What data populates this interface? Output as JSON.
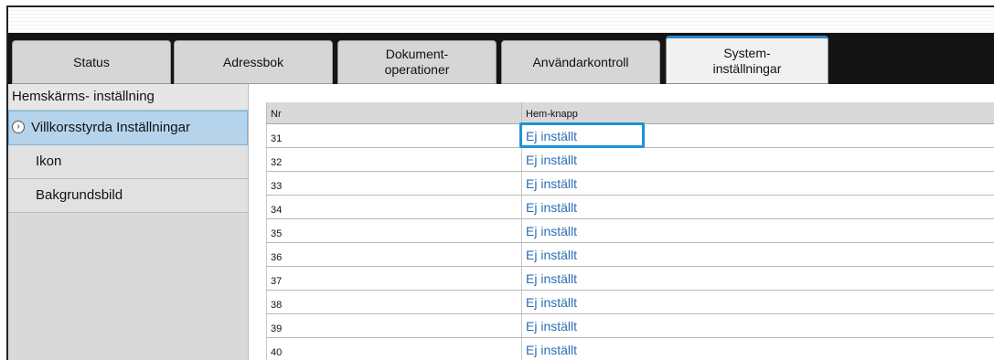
{
  "tabs": [
    {
      "label": "Status"
    },
    {
      "label": "Adressbok"
    },
    {
      "label": "Dokument-\noperationer"
    },
    {
      "label": "Användarkontroll"
    },
    {
      "label": "System-\ninställningar"
    }
  ],
  "sidebar": {
    "header": "Hemskärms- inställning",
    "items": [
      {
        "label": "Villkorsstyrda Inställningar"
      },
      {
        "label": "Ikon"
      },
      {
        "label": "Bakgrundsbild"
      }
    ]
  },
  "table": {
    "columns": [
      "Nr",
      "Hem-knapp"
    ],
    "rows": [
      {
        "nr": "31",
        "value": "Ej inställt"
      },
      {
        "nr": "32",
        "value": "Ej inställt"
      },
      {
        "nr": "33",
        "value": "Ej inställt"
      },
      {
        "nr": "34",
        "value": "Ej inställt"
      },
      {
        "nr": "35",
        "value": "Ej inställt"
      },
      {
        "nr": "36",
        "value": "Ej inställt"
      },
      {
        "nr": "37",
        "value": "Ej inställt"
      },
      {
        "nr": "38",
        "value": "Ej inställt"
      },
      {
        "nr": "39",
        "value": "Ej inställt"
      },
      {
        "nr": "40",
        "value": "Ej inställt"
      }
    ]
  },
  "colors": {
    "accent": "#2e86c8",
    "link": "#2a6fb7",
    "focus": "#1f93d6",
    "selected": "#b5d4ec"
  }
}
